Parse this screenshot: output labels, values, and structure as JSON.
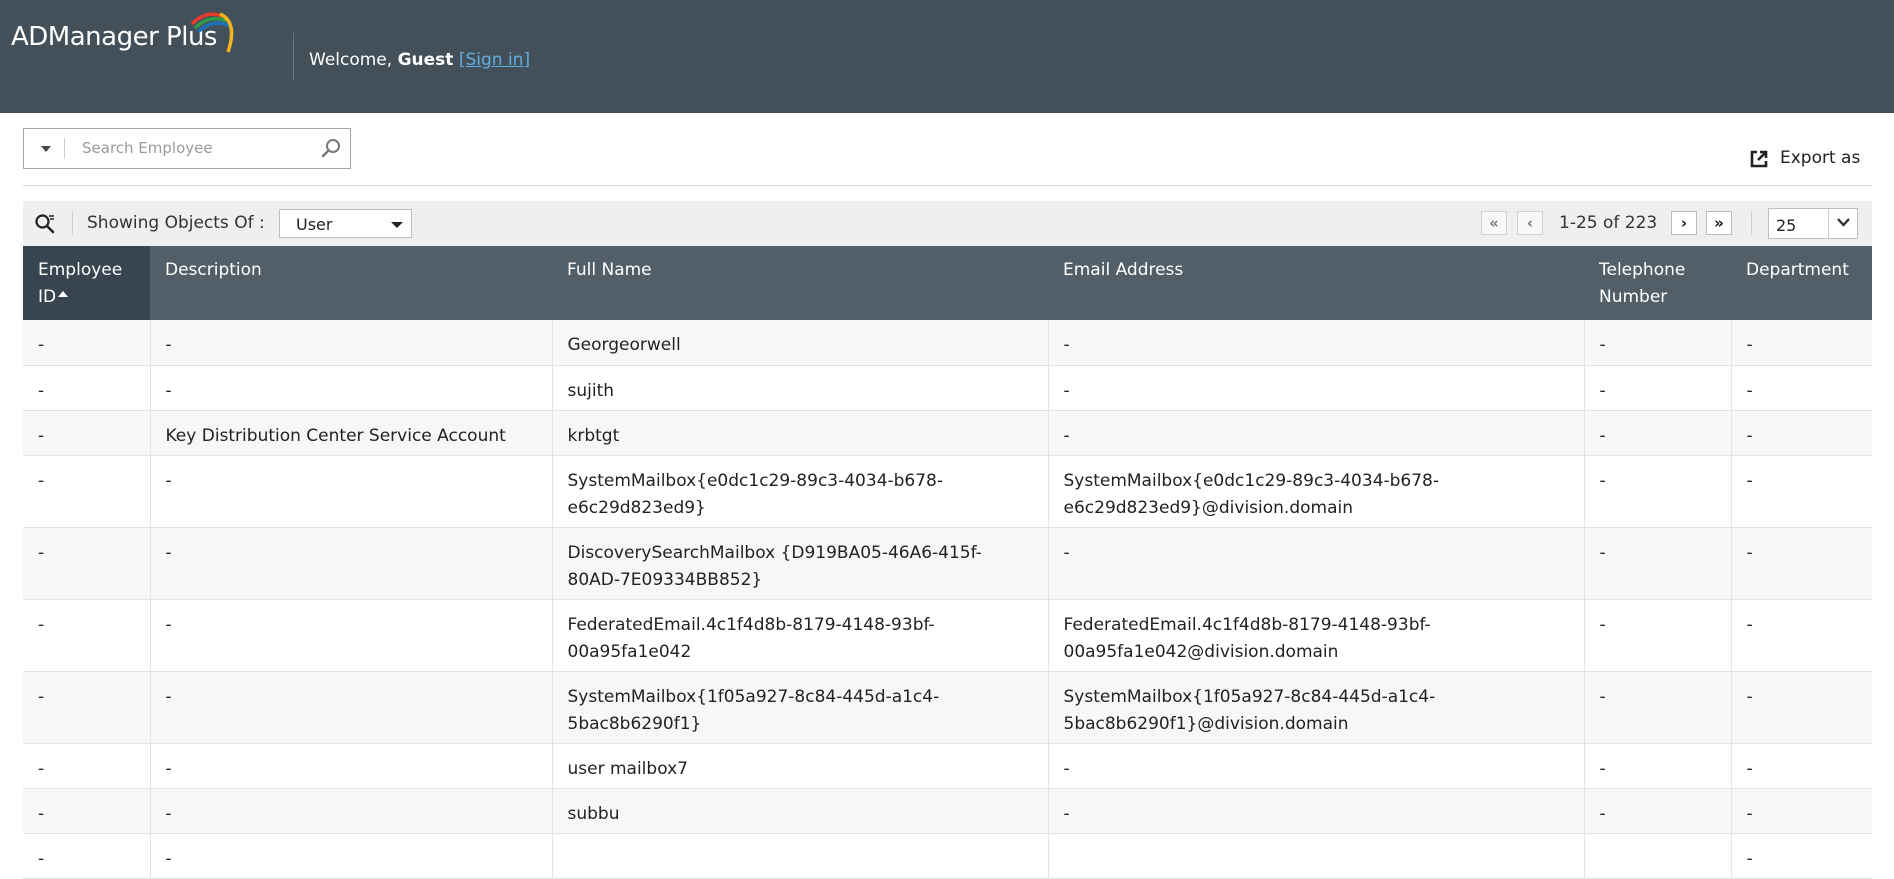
{
  "app": {
    "logo_text": "ADManager Plus",
    "welcome_prefix": "Welcome,",
    "user": "Guest",
    "signin": "[Sign in]"
  },
  "search": {
    "placeholder": "Search Employee"
  },
  "export": {
    "label": "Export as"
  },
  "toolbar": {
    "showing_label": "Showing Objects Of :",
    "object_type": "User",
    "page_info": "1-25 of 223",
    "page_size": "25"
  },
  "columns": [
    "Employee ID",
    "Description",
    "Full Name",
    "Email Address",
    "Telephone Number",
    "Department"
  ],
  "rows": [
    [
      "-",
      "-",
      "Georgeorwell",
      "-",
      "-",
      "-"
    ],
    [
      "-",
      "-",
      "sujith",
      "-",
      "-",
      "-"
    ],
    [
      "-",
      "Key Distribution Center Service Account",
      "krbtgt",
      "-",
      "-",
      "-"
    ],
    [
      "-",
      "-",
      "SystemMailbox{e0dc1c29-89c3-4034-b678-e6c29d823ed9}",
      "SystemMailbox{e0dc1c29-89c3-4034-b678-e6c29d823ed9}@division.domain",
      "-",
      "-"
    ],
    [
      "-",
      "-",
      "DiscoverySearchMailbox {D919BA05-46A6-415f-80AD-7E09334BB852}",
      "-",
      "-",
      "-"
    ],
    [
      "-",
      "-",
      "FederatedEmail.4c1f4d8b-8179-4148-93bf-00a95fa1e042",
      "FederatedEmail.4c1f4d8b-8179-4148-93bf-00a95fa1e042@division.domain",
      "-",
      "-"
    ],
    [
      "-",
      "-",
      "SystemMailbox{1f05a927-8c84-445d-a1c4-5bac8b6290f1}",
      "SystemMailbox{1f05a927-8c84-445d-a1c4-5bac8b6290f1}@division.domain",
      "-",
      "-"
    ],
    [
      "-",
      "-",
      "user mailbox7",
      "-",
      "-",
      "-"
    ],
    [
      "-",
      "-",
      "subbu",
      "-",
      "-",
      "-"
    ],
    [
      "-",
      "-",
      "",
      "",
      "",
      "-"
    ]
  ],
  "icons": {
    "logo": "rainbow-arc-icon",
    "search": "magnifier-icon",
    "export": "export-icon",
    "toolbar_search": "search-filter-icon",
    "first": "double-chevron-left-icon",
    "prev": "chevron-left-icon",
    "next": "chevron-right-icon",
    "last": "double-chevron-right-icon"
  },
  "colors": {
    "header_bg": "#434f59",
    "table_header_bg": "#535f68",
    "sorted_header_bg": "#384450",
    "link": "#62aee2"
  }
}
